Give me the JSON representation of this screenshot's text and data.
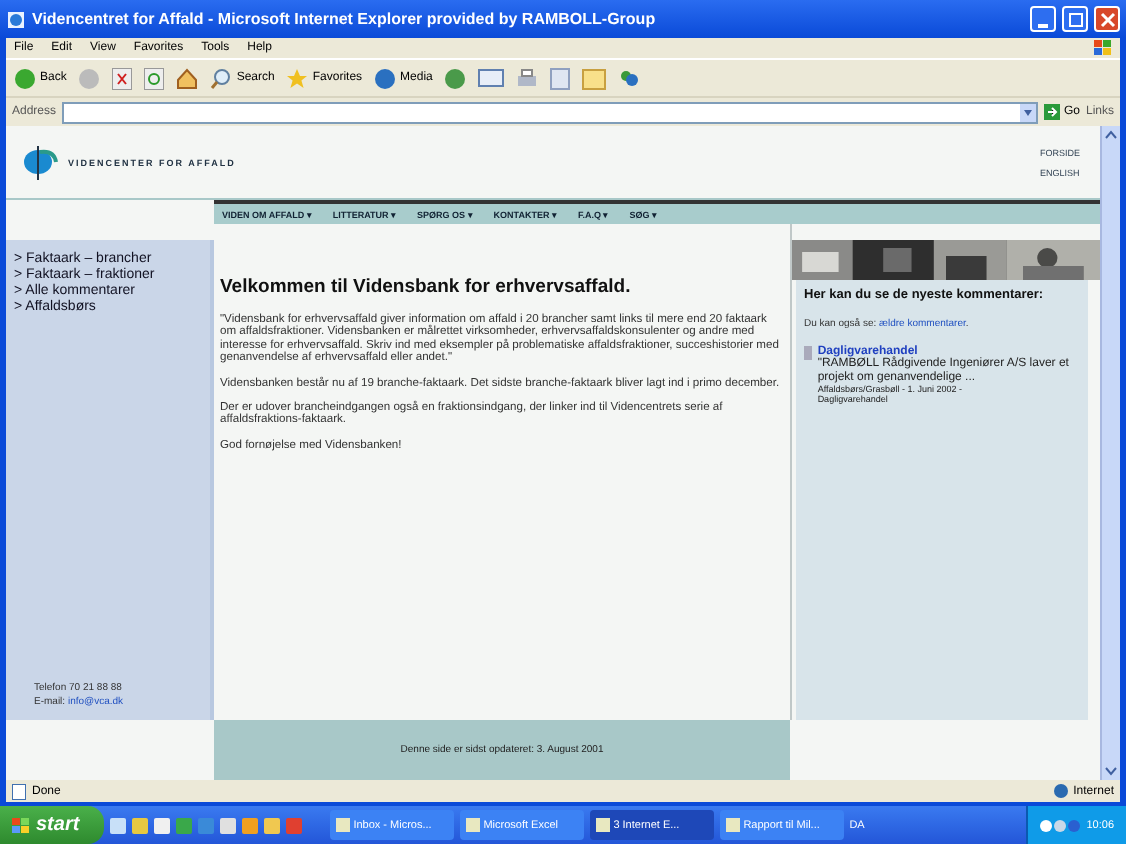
{
  "window": {
    "title": "Videncentret for Affald - Microsoft Internet Explorer provided by RAMBOLL-Group"
  },
  "menu": [
    "File",
    "Edit",
    "View",
    "Favorites",
    "Tools",
    "Help"
  ],
  "toolbar": {
    "back": "Back",
    "search": "Search",
    "favorites": "Favorites",
    "media": "Media"
  },
  "address": {
    "label": "Address",
    "go": "Go",
    "links": "Links"
  },
  "site": {
    "logo_text": "VIDENCENTER FOR AFFALD",
    "header_links": [
      "FORSIDE",
      "ENGLISH"
    ],
    "nav": [
      {
        "label": "VIDEN OM AFFALD",
        "caret": "▾"
      },
      {
        "label": "LITTERATUR",
        "caret": "▾"
      },
      {
        "label": "SPØRG OS",
        "caret": "▾"
      },
      {
        "label": "KONTAKTER",
        "caret": "▾"
      },
      {
        "label": "F.A.Q",
        "caret": "▾"
      },
      {
        "label": "SØG",
        "caret": "▾"
      }
    ],
    "sidebar": {
      "items": [
        "> Faktaark – brancher",
        "> Faktaark – fraktioner",
        "> Alle kommentarer",
        "> Affaldsbørs"
      ],
      "phone": "Telefon 70 21 88 88",
      "email_label": "E-mail:",
      "email": "info@vca.dk"
    },
    "heading": "Velkommen til Vidensbank for erhvervsaffald.",
    "paragraphs": [
      "\"Vidensbank for erhvervsaffald giver information om affald i 20 brancher samt links til mere end 20 faktaark om affaldsfraktioner. Vidensbanken er målrettet virksomheder, erhvervsaffaldskonsulenter og andre med interesse for erhvervsaffald. Skriv ind med eksempler på problematiske affaldsfraktioner, succeshistorier med genanvendelse af erhvervsaffald eller andet.\"",
      "Vidensbanken består nu af 19 branche-faktaark. Det sidste branche-faktaark bliver lagt ind i primo december.",
      "Der er udover brancheindgangen også en fraktionsindgang, der linker ind til Videncentrets serie af affaldsfraktions-faktaark.",
      "God fornøjelse med Vidensbanken!"
    ],
    "footer": "Denne side er sidst opdateret: 3. August 2001",
    "comments": {
      "title": "Her kan du se de nyeste kommentarer:",
      "also": "Du kan også se:",
      "also_link": "ældre kommentarer",
      "also_end": ".",
      "items": [
        {
          "title": "Dagligvarehandel",
          "text": "\"RAMBØLL Rådgivende Ingeniører A/S laver et projekt om genanvendelige ...",
          "meta": "Affaldsbørs/Grasbøll - 1. Juni 2002 -",
          "category": "Dagligvarehandel"
        }
      ]
    }
  },
  "status": {
    "text": "Done",
    "zone": "Internet"
  },
  "taskbar": {
    "start": "start",
    "tasks": [
      {
        "label": "Inbox - Micros...",
        "selected": false
      },
      {
        "label": "Microsoft Excel",
        "selected": false
      },
      {
        "label": "3 Internet E...",
        "selected": true
      },
      {
        "label": "Rapport til Mil...",
        "selected": false
      }
    ],
    "language": "DA",
    "clock": "10:06"
  }
}
